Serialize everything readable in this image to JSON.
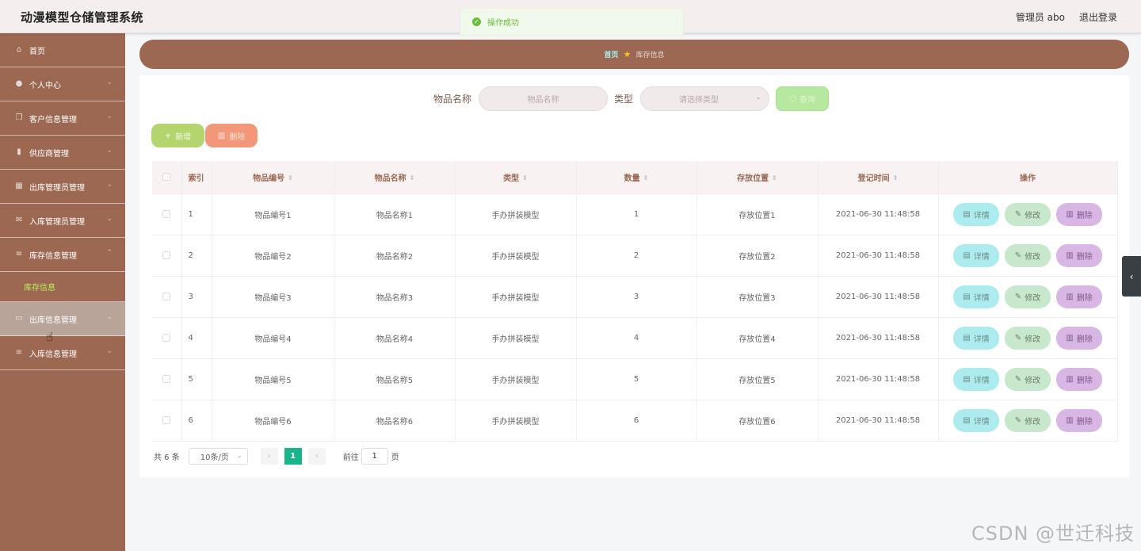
{
  "header": {
    "title": "动漫模型仓储管理系统",
    "user": "管理员 abo",
    "logout": "退出登录"
  },
  "toast": {
    "message": "操作成功"
  },
  "sidebar": {
    "items": [
      {
        "label": "首页",
        "icon": "home-icon",
        "chevron": false
      },
      {
        "label": "个人中心",
        "icon": "user-icon",
        "chevron": true
      },
      {
        "label": "客户信息管理",
        "icon": "copy-icon",
        "chevron": true
      },
      {
        "label": "供应商管理",
        "icon": "trash-icon",
        "chevron": true
      },
      {
        "label": "出库管理员管理",
        "icon": "grid-icon",
        "chevron": true
      },
      {
        "label": "入库管理员管理",
        "icon": "mail-icon",
        "chevron": true
      },
      {
        "label": "库存信息管理",
        "icon": "list-icon",
        "chevron": true,
        "expanded": true
      },
      {
        "label": "出库信息管理",
        "icon": "card-icon",
        "chevron": true,
        "active": true
      },
      {
        "label": "入库信息管理",
        "icon": "list-icon",
        "chevron": true
      }
    ],
    "submenu": {
      "label": "库存信息"
    }
  },
  "breadcrumb": {
    "home": "首页",
    "current": "库存信息"
  },
  "search": {
    "name_label": "物品名称",
    "name_placeholder": "物品名称",
    "type_label": "类型",
    "type_placeholder": "请选择类型",
    "query_label": "查询"
  },
  "actions": {
    "add_label": "新增",
    "delete_label": "删除"
  },
  "table": {
    "headers": [
      "索引",
      "物品编号",
      "物品名称",
      "类型",
      "数量",
      "存放位置",
      "登记时间",
      "操作"
    ],
    "rows": [
      {
        "idx": "1",
        "code": "物品编号1",
        "name": "物品名称1",
        "type": "手办拼装模型",
        "qty": "1",
        "loc": "存放位置1",
        "time": "2021-06-30 11:48:58"
      },
      {
        "idx": "2",
        "code": "物品编号2",
        "name": "物品名称2",
        "type": "手办拼装模型",
        "qty": "2",
        "loc": "存放位置2",
        "time": "2021-06-30 11:48:58"
      },
      {
        "idx": "3",
        "code": "物品编号3",
        "name": "物品名称3",
        "type": "手办拼装模型",
        "qty": "3",
        "loc": "存放位置3",
        "time": "2021-06-30 11:48:58"
      },
      {
        "idx": "4",
        "code": "物品编号4",
        "name": "物品名称4",
        "type": "手办拼装模型",
        "qty": "4",
        "loc": "存放位置4",
        "time": "2021-06-30 11:48:58"
      },
      {
        "idx": "5",
        "code": "物品编号5",
        "name": "物品名称5",
        "type": "手办拼装模型",
        "qty": "5",
        "loc": "存放位置5",
        "time": "2021-06-30 11:48:58"
      },
      {
        "idx": "6",
        "code": "物品编号6",
        "name": "物品名称6",
        "type": "手办拼装模型",
        "qty": "6",
        "loc": "存放位置6",
        "time": "2021-06-30 11:48:58"
      }
    ],
    "row_actions": {
      "detail": "详情",
      "edit": "修改",
      "delete": "删除"
    }
  },
  "pagination": {
    "total": "共 6 条",
    "page_size": "10条/页",
    "current_page": "1",
    "goto_prefix": "前往",
    "goto_value": "1",
    "goto_suffix": "页"
  },
  "watermark": "CSDN @世迁科技"
}
